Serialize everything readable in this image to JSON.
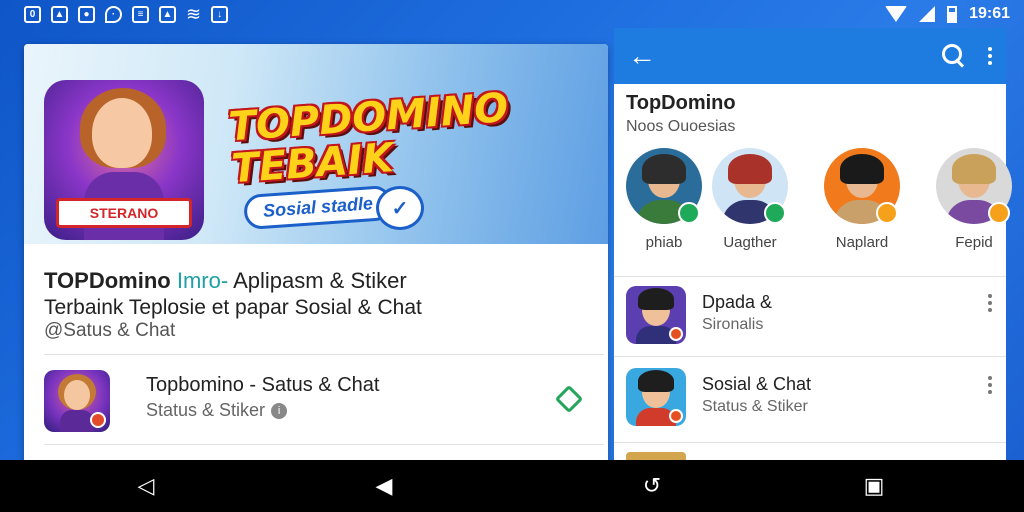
{
  "status_bar": {
    "time": "19:61",
    "left_icons": [
      "notification-icon",
      "image-icon",
      "app-icon",
      "location-icon",
      "signal-icon",
      "image-icon",
      "wifi-icon",
      "download-icon"
    ]
  },
  "left_card": {
    "banner": {
      "icon_tag": "STERANO",
      "title": "TOPDOMINO TEBAIK",
      "subtitle": "Sosial stadle"
    },
    "title_bold": "TOPDomino",
    "title_teal": "Imro-",
    "title_rest": "Aplipasm & Stiker",
    "line2": "Terbaink Teplosie et papar Sosial & Chat",
    "line3": "@Satus & Chat",
    "app": {
      "name": "Topbomino - Satus & Chat",
      "subtitle": "Status & Stiker",
      "info_glyph": "i"
    }
  },
  "right_panel": {
    "toolbar": {
      "back_glyph": "←"
    },
    "title": "TopDomino",
    "subtitle": "Noos Ouoesias",
    "avatars": [
      {
        "label": "phiab",
        "hair": "#2d2d2d",
        "shirt": "#3a7a3a",
        "bg": "#2a6d9b",
        "badge": "#1faa5a"
      },
      {
        "label": "Uagther",
        "hair": "#a9322b",
        "shirt": "#31356e",
        "bg": "#cfe4f5",
        "badge": "#1faa5a"
      },
      {
        "label": "Naplard",
        "hair": "#1a1a1a",
        "shirt": "#caa06a",
        "bg": "#f07a1c",
        "badge": "#f7a11a"
      },
      {
        "label": "Fepid",
        "hair": "#caa15a",
        "shirt": "#7a4aa0",
        "bg": "#d9d9d9",
        "badge": "#f7a11a"
      }
    ],
    "rows": [
      {
        "name": "Dpada &",
        "subtitle": "Sironalis",
        "bg": "#5b3fb0",
        "shirt": "#2f2f7a"
      },
      {
        "name": "Sosial & Chat",
        "subtitle": "Status & Stiker",
        "bg": "#3aa8e0",
        "shirt": "#d13b2b"
      }
    ]
  },
  "navbar": {
    "back_glyph": "◁",
    "home_glyph": "◀",
    "rotate_glyph": "↺",
    "recent_glyph": "▣"
  }
}
